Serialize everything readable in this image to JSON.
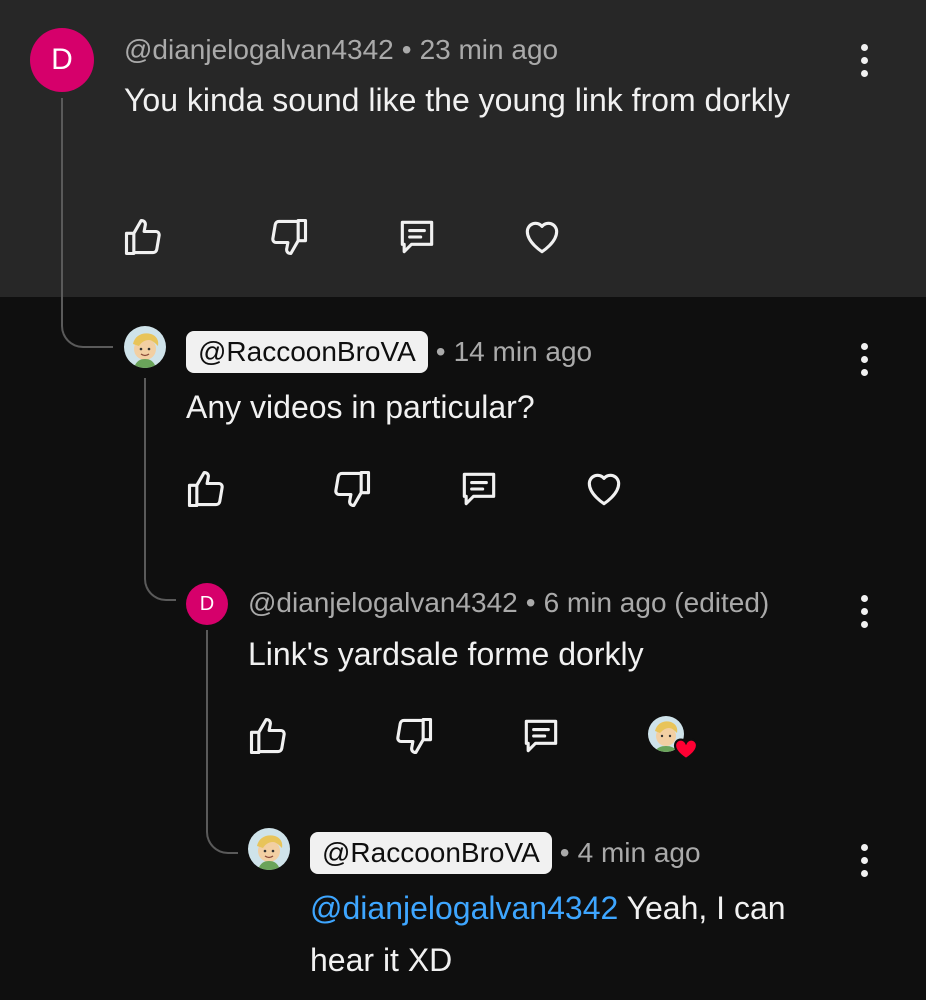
{
  "colors": {
    "mention": "#3ea6ff",
    "avatar_letter_bg": "#d6006b",
    "heart_badge": "#ff0033"
  },
  "comments": [
    {
      "avatar_letter": "D",
      "author": "@dianjelogalvan4342",
      "separator": "•",
      "time": "23 min ago",
      "text": "You kinda sound like the young link from dorkly",
      "actions": [
        "like-icon",
        "dislike-icon",
        "reply-icon",
        "heart-icon"
      ]
    },
    {
      "avatar": "cartoon-avatar",
      "author": "@RaccoonBroVA",
      "separator": "•",
      "time": "14 min ago",
      "text": "Any videos in particular?",
      "actions": [
        "like-icon",
        "dislike-icon",
        "reply-icon",
        "heart-icon"
      ]
    },
    {
      "avatar_letter": "D",
      "author": "@dianjelogalvan4342",
      "separator": "•",
      "time": "6 min ago (edited)",
      "text": "Link's yardsale forme dorkly",
      "actions": [
        "like-icon",
        "dislike-icon",
        "reply-icon",
        "creator-hearted-icon"
      ]
    },
    {
      "avatar": "cartoon-avatar",
      "author": "@RaccoonBroVA",
      "separator": "•",
      "time": "4 min ago",
      "mention": "@dianjelogalvan4342",
      "text_line1": " Yeah, I can",
      "text_line2": "hear it XD",
      "actions": []
    }
  ]
}
